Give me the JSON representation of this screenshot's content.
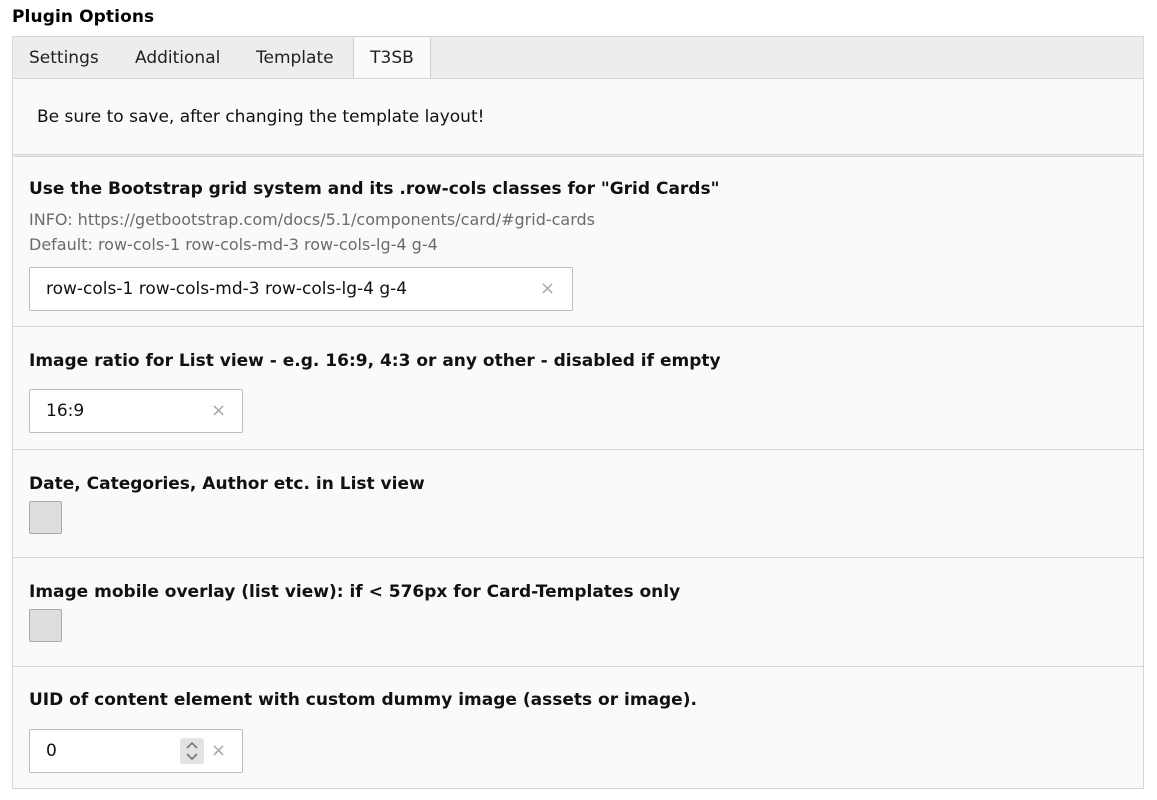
{
  "header": {
    "title": "Plugin Options"
  },
  "tabs": [
    {
      "label": "Settings",
      "active": false
    },
    {
      "label": "Additional",
      "active": false
    },
    {
      "label": "Template",
      "active": false
    },
    {
      "label": "T3SB",
      "active": true
    }
  ],
  "notice": "Be sure to save, after changing the template layout!",
  "fields": {
    "grid": {
      "label": "Use the Bootstrap grid system and its .row-cols classes for \"Grid Cards\"",
      "info": "INFO: https://getbootstrap.com/docs/5.1/components/card/#grid-cards",
      "default": "Default: row-cols-1 row-cols-md-3 row-cols-lg-4 g-4",
      "value": "row-cols-1 row-cols-md-3 row-cols-lg-4 g-4"
    },
    "ratio": {
      "label": "Image ratio for List view - e.g. 16:9, 4:3 or any other - disabled if empty",
      "value": "16:9"
    },
    "meta": {
      "label": "Date, Categories, Author etc. in List view",
      "checked": false
    },
    "overlay": {
      "label": "Image mobile overlay (list view): if < 576px for Card-Templates only",
      "checked": false
    },
    "uid": {
      "label": "UID of content element with custom dummy image (assets or image).",
      "value": "0"
    }
  },
  "icons": {
    "clear": "×",
    "clear_icon_name": "close-icon",
    "spinner_icon_name": "spinner-icon"
  },
  "colors": {
    "tabbar_bg": "#ededed",
    "panel_bg": "#fafafa",
    "border": "#d5d5d5",
    "muted_text": "#6b6b6b"
  }
}
